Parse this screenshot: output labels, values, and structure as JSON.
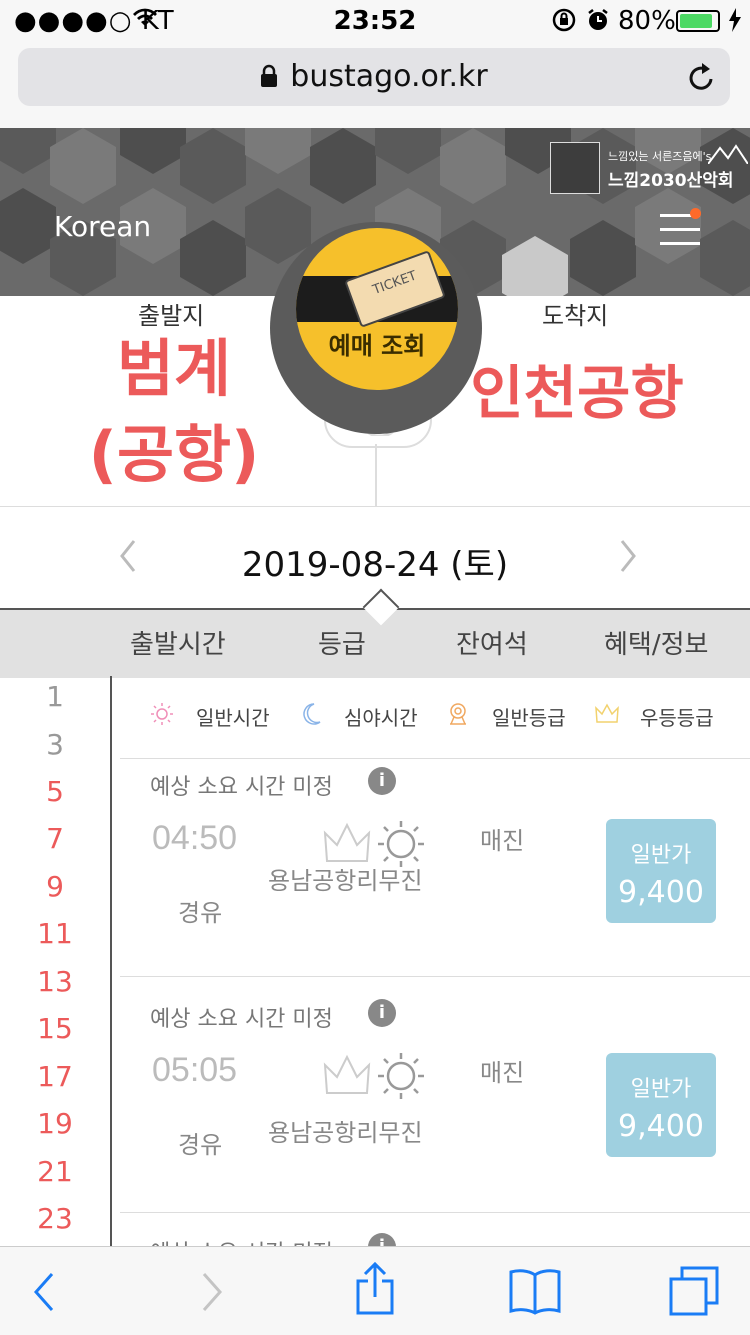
{
  "status_bar": {
    "carrier": "●●●●○ KT",
    "time": "23:52",
    "battery_percent": "80%",
    "battery_level": 0.8
  },
  "browser": {
    "url": "bustago.or.kr"
  },
  "header": {
    "language": "Korean",
    "promo": {
      "line1": "느낌있는 서른즈음에's",
      "line2": "느낌2030산악회"
    }
  },
  "route": {
    "departure_label": "출발지",
    "departure_lines": [
      "범계",
      "(공항)"
    ],
    "arrival_label": "도착지",
    "arrival": "인천공항",
    "ticket_button": "예매 조회",
    "ticket_card_text": "TICKET"
  },
  "date": {
    "value": "2019-08-24 (토)"
  },
  "tabs": [
    "출발시간",
    "등급",
    "잔여석",
    "혜택/정보"
  ],
  "hours": [
    "1",
    "3",
    "5",
    "7",
    "9",
    "11",
    "13",
    "15",
    "17",
    "19",
    "21",
    "23"
  ],
  "legend": [
    "일반시간",
    "심야시간",
    "일반등급",
    "우등등급"
  ],
  "results": [
    {
      "estimate": "예상 소요 시간 미정",
      "time": "04:50",
      "via": "경유",
      "company": "용남공항리무진",
      "status": "매진",
      "fare_type": "일반가",
      "fare": "9,400"
    },
    {
      "estimate": "예상 소요 시간 미정",
      "time": "05:05",
      "via": "경유",
      "company": "용남공항리무진",
      "status": "매진",
      "fare_type": "일반가",
      "fare": "9,400"
    },
    {
      "estimate": "예상 소요 시간 미정"
    }
  ],
  "colors": {
    "accent_red": "#ec5a5a",
    "ticket_yellow": "#f6c02b",
    "price_blue": "#9fd0e0",
    "ios_blue": "#1a7cf5"
  }
}
